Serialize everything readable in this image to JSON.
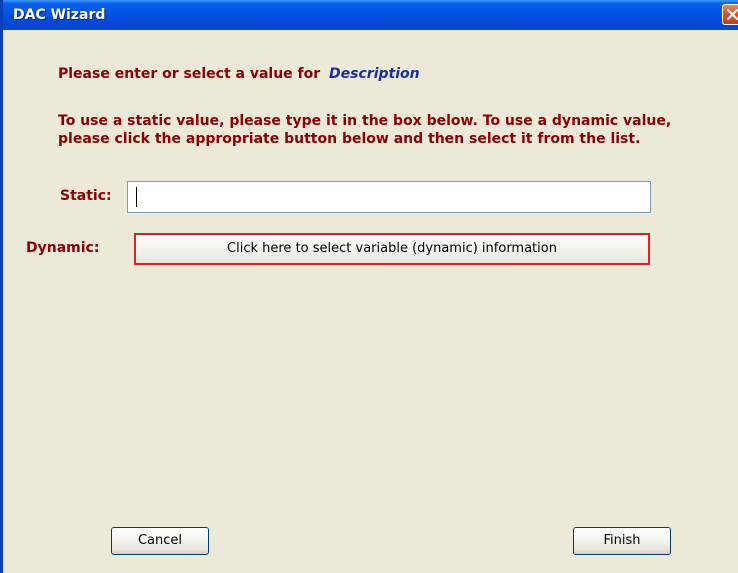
{
  "window": {
    "title": "DAC Wizard"
  },
  "prompt": {
    "text": "Please enter or select a value for",
    "field_name": "Description"
  },
  "instructions": "To use a static value, please type it in the box below.  To use a dynamic value, please click the appropriate button below and then select it from the list.",
  "static": {
    "label": "Static:",
    "value": ""
  },
  "dynamic": {
    "label": "Dynamic:",
    "button_label": "Click here to select variable (dynamic) information"
  },
  "footer": {
    "cancel_label": "Cancel",
    "finish_label": "Finish"
  },
  "icons": {
    "close": "close-icon"
  },
  "colors": {
    "label_text": "#8b0000",
    "field_name_text": "#1c2f98",
    "highlight_border": "#e02020",
    "title_bar": "#0055e5",
    "dialog_background": "#ece9d8"
  }
}
